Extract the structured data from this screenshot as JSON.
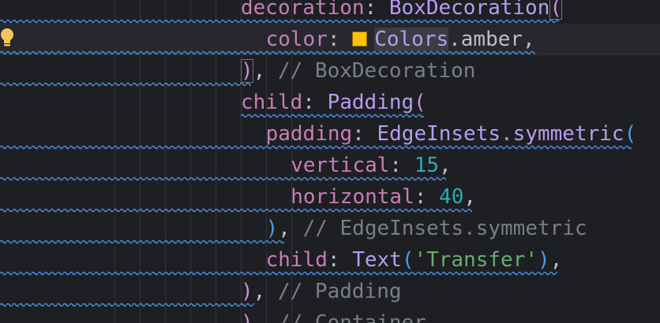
{
  "code_lines": [
    {
      "indent": "",
      "parts": [
        {
          "t": "decoration",
          "c": "prop"
        },
        {
          "t": ": ",
          "c": "op"
        },
        {
          "t": "BoxDecoration",
          "c": "cls"
        },
        {
          "t": "(",
          "c": "brk-pink"
        }
      ]
    },
    {
      "indent": "  ",
      "parts": [
        {
          "t": "color",
          "c": "prop"
        },
        {
          "t": ": ",
          "c": "op"
        },
        {
          "t": "Colors",
          "c": "cls"
        },
        {
          "t": ".amber,",
          "c": "punc"
        }
      ]
    },
    {
      "indent": "",
      "parts": [
        {
          "t": ")",
          "c": "brk-pink"
        },
        {
          "t": ", ",
          "c": "punc"
        },
        {
          "t": "// BoxDecoration",
          "c": "cmt"
        }
      ]
    },
    {
      "indent": "",
      "parts": [
        {
          "t": "child",
          "c": "prop"
        },
        {
          "t": ": ",
          "c": "op"
        },
        {
          "t": "Padding",
          "c": "cls"
        },
        {
          "t": "(",
          "c": "brk-pink"
        }
      ]
    },
    {
      "indent": "  ",
      "parts": [
        {
          "t": "padding",
          "c": "prop"
        },
        {
          "t": ": ",
          "c": "op"
        },
        {
          "t": "EdgeInsets",
          "c": "cls"
        },
        {
          "t": ".symmetric",
          "c": "cls"
        },
        {
          "t": "(",
          "c": "brk-blue"
        }
      ]
    },
    {
      "indent": "    ",
      "parts": [
        {
          "t": "vertical",
          "c": "prop"
        },
        {
          "t": ": ",
          "c": "op"
        },
        {
          "t": "15",
          "c": "num"
        },
        {
          "t": ",",
          "c": "punc"
        }
      ]
    },
    {
      "indent": "    ",
      "parts": [
        {
          "t": "horizontal",
          "c": "prop"
        },
        {
          "t": ": ",
          "c": "op"
        },
        {
          "t": "40",
          "c": "num"
        },
        {
          "t": ",",
          "c": "punc"
        }
      ]
    },
    {
      "indent": "  ",
      "parts": [
        {
          "t": ")",
          "c": "brk-blue"
        },
        {
          "t": ", ",
          "c": "punc"
        },
        {
          "t": "// EdgeInsets.symmetric",
          "c": "cmt"
        }
      ]
    },
    {
      "indent": "  ",
      "parts": [
        {
          "t": "child",
          "c": "prop"
        },
        {
          "t": ": ",
          "c": "op"
        },
        {
          "t": "Text",
          "c": "cls"
        },
        {
          "t": "(",
          "c": "brk-blue"
        },
        {
          "t": "'Transfer'",
          "c": "str"
        },
        {
          "t": ")",
          "c": "brk-blue"
        },
        {
          "t": ",",
          "c": "punc"
        }
      ]
    },
    {
      "indent": "",
      "parts": [
        {
          "t": ")",
          "c": "brk-pink"
        },
        {
          "t": ", ",
          "c": "punc"
        },
        {
          "t": "// Padding",
          "c": "cmt"
        }
      ]
    },
    {
      "indent": "",
      "parts": [
        {
          "t": ")",
          "c": "brk-pink"
        },
        {
          "t": ", ",
          "c": "punc"
        },
        {
          "t": "// Container",
          "c": "cmt"
        }
      ]
    }
  ],
  "color_swatch": {
    "value": "#FFC107",
    "name": "Colors.amber"
  },
  "icons": {
    "gutter": "lightbulb-icon"
  },
  "colors": {
    "background": "#1e1f22",
    "caret_line": "#26282e",
    "property": "#c77dbb",
    "class": "#b89cf0",
    "number": "#2aacb8",
    "string": "#6aab73",
    "comment": "#7a7e85",
    "squiggle": "#4a88d8"
  }
}
